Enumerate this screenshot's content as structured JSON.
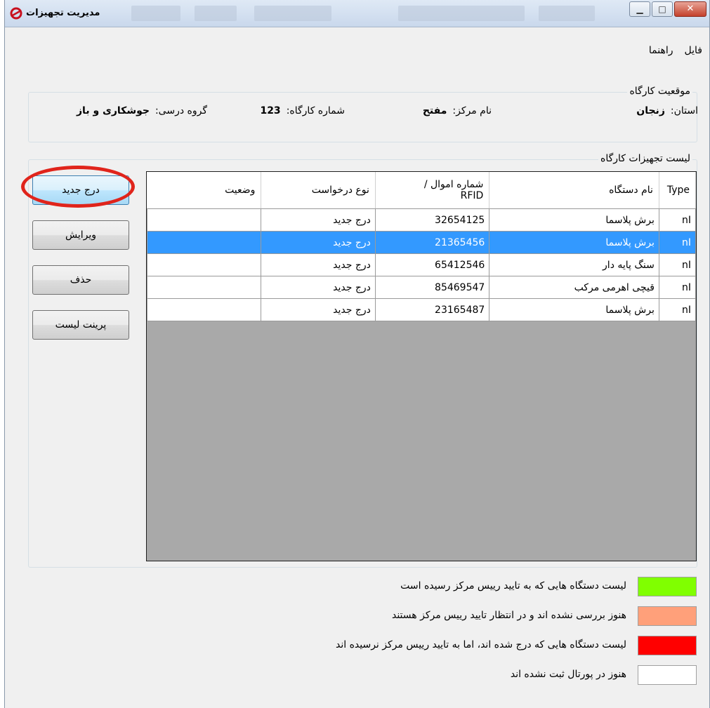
{
  "window": {
    "title": "مدیریت تجهیزات"
  },
  "menu": {
    "items": [
      {
        "label": "فایل"
      },
      {
        "label": "راهنما"
      }
    ]
  },
  "location": {
    "legend": "موقعیت کارگاه",
    "province_label": "استان:",
    "province_value": "زنجان",
    "center_label": "نام مرکز:",
    "center_value": "مفتح",
    "workshop_label": "شماره کارگاه:",
    "workshop_value": "123",
    "group_label": "گروه درسی:",
    "group_value": "جوشکاری و باز"
  },
  "equipment": {
    "legend": "لیست تجهیزات کارگاه",
    "buttons": {
      "add": "درج جدید",
      "edit": "ویرایش",
      "delete": "حذف",
      "print": "پرینت لیست"
    },
    "columns": {
      "type": "Type",
      "name": "نام دستگاه",
      "rfid_line1": "شماره اموال /",
      "rfid_line2": "RFID",
      "request": "نوع درخواست",
      "status": "وضعیت"
    },
    "rows": [
      {
        "type": "nI",
        "name": "برش پلاسما",
        "rfid": "32654125",
        "request": "درج جدید",
        "status": ""
      },
      {
        "type": "nI",
        "name": "برش پلاسما",
        "rfid": "21365456",
        "request": "درج جدید",
        "status": ""
      },
      {
        "type": "nI",
        "name": "سنگ پایه دار",
        "rfid": "65412546",
        "request": "درج جدید",
        "status": ""
      },
      {
        "type": "nI",
        "name": "قیچی اهرمی مرکب",
        "rfid": "85469547",
        "request": "درج جدید",
        "status": ""
      },
      {
        "type": "nI",
        "name": "برش پلاسما",
        "rfid": "23165487",
        "request": "درج جدید",
        "status": ""
      }
    ],
    "selected_row_index": 1
  },
  "color_legend": [
    {
      "text": "لیست دستگاه هایی که به تایید رییس مرکز رسیده است",
      "color": "#80ff00"
    },
    {
      "text": "هنوز بررسی نشده اند و در انتظار تایید رییس مرکز هستند",
      "color": "#ffa07a"
    },
    {
      "text": "لیست دستگاه هایی که درج شده اند، اما به تایید رییس مرکز نرسیده اند",
      "color": "#ff0000"
    },
    {
      "text": "هنوز در پورتال ثبت نشده اند",
      "color": "#ffffff"
    }
  ],
  "colors": {
    "selection": "#3399ff",
    "highlight_ellipse": "#e0241b"
  }
}
